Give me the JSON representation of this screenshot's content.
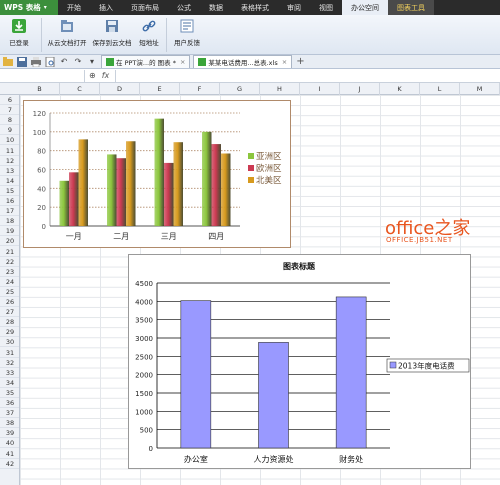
{
  "app": {
    "name": "WPS 表格"
  },
  "menu": [
    "开始",
    "插入",
    "页面布局",
    "公式",
    "数据",
    "表格样式",
    "审阅",
    "视图",
    "办公空间",
    "图表工具"
  ],
  "ribbon": {
    "logged_in": "已登录",
    "open_cloud": "从云文档打开",
    "save_cloud": "保存到云文档",
    "short_url": "短地址",
    "feedback": "用户反馈"
  },
  "tabs": [
    {
      "label": "在 PPT演...的 图表 *"
    },
    {
      "label": "某某电话费用...总表.xls"
    }
  ],
  "formula": {
    "fx": "fx"
  },
  "columns": [
    "B",
    "C",
    "D",
    "E",
    "F",
    "G",
    "H",
    "I",
    "J",
    "K",
    "L",
    "M"
  ],
  "rows": [
    "6",
    "7",
    "8",
    "9",
    "10",
    "11",
    "12",
    "13",
    "14",
    "15",
    "16",
    "17",
    "18",
    "19",
    "20",
    "21",
    "22",
    "23",
    "24",
    "25",
    "26",
    "27",
    "28",
    "29",
    "30",
    "31",
    "32",
    "33",
    "34",
    "35",
    "36",
    "37",
    "38",
    "39",
    "40",
    "41",
    "42"
  ],
  "chart_data": [
    {
      "type": "bar",
      "title": "",
      "categories": [
        "一月",
        "二月",
        "三月",
        "四月"
      ],
      "series": [
        {
          "name": "亚洲区",
          "values": [
            48,
            76,
            114,
            100
          ],
          "color": "#8cc63e"
        },
        {
          "name": "欧洲区",
          "values": [
            57,
            72,
            67,
            87
          ],
          "color": "#cc3a52"
        },
        {
          "name": "北美区",
          "values": [
            92,
            90,
            89,
            77
          ],
          "color": "#d79a1e"
        }
      ],
      "yticks": [
        "0",
        "20",
        "40",
        "60",
        "80",
        "100",
        "120"
      ],
      "ylim": [
        0,
        120
      ],
      "legend": "right"
    },
    {
      "type": "bar",
      "title": "图表标题",
      "categories": [
        "办公室",
        "人力资源处",
        "财务处"
      ],
      "series": [
        {
          "name": "2013年度电话费",
          "values": [
            4020,
            2880,
            4120
          ],
          "color": "#9999ff"
        }
      ],
      "yticks": [
        "0",
        "500",
        "1000",
        "1500",
        "2000",
        "2500",
        "3000",
        "3500",
        "4000",
        "4500"
      ],
      "ylim": [
        0,
        4500
      ],
      "legend": "right"
    }
  ],
  "watermark": {
    "main": "office之家",
    "sub": "OFFICE.JB51.NET"
  }
}
